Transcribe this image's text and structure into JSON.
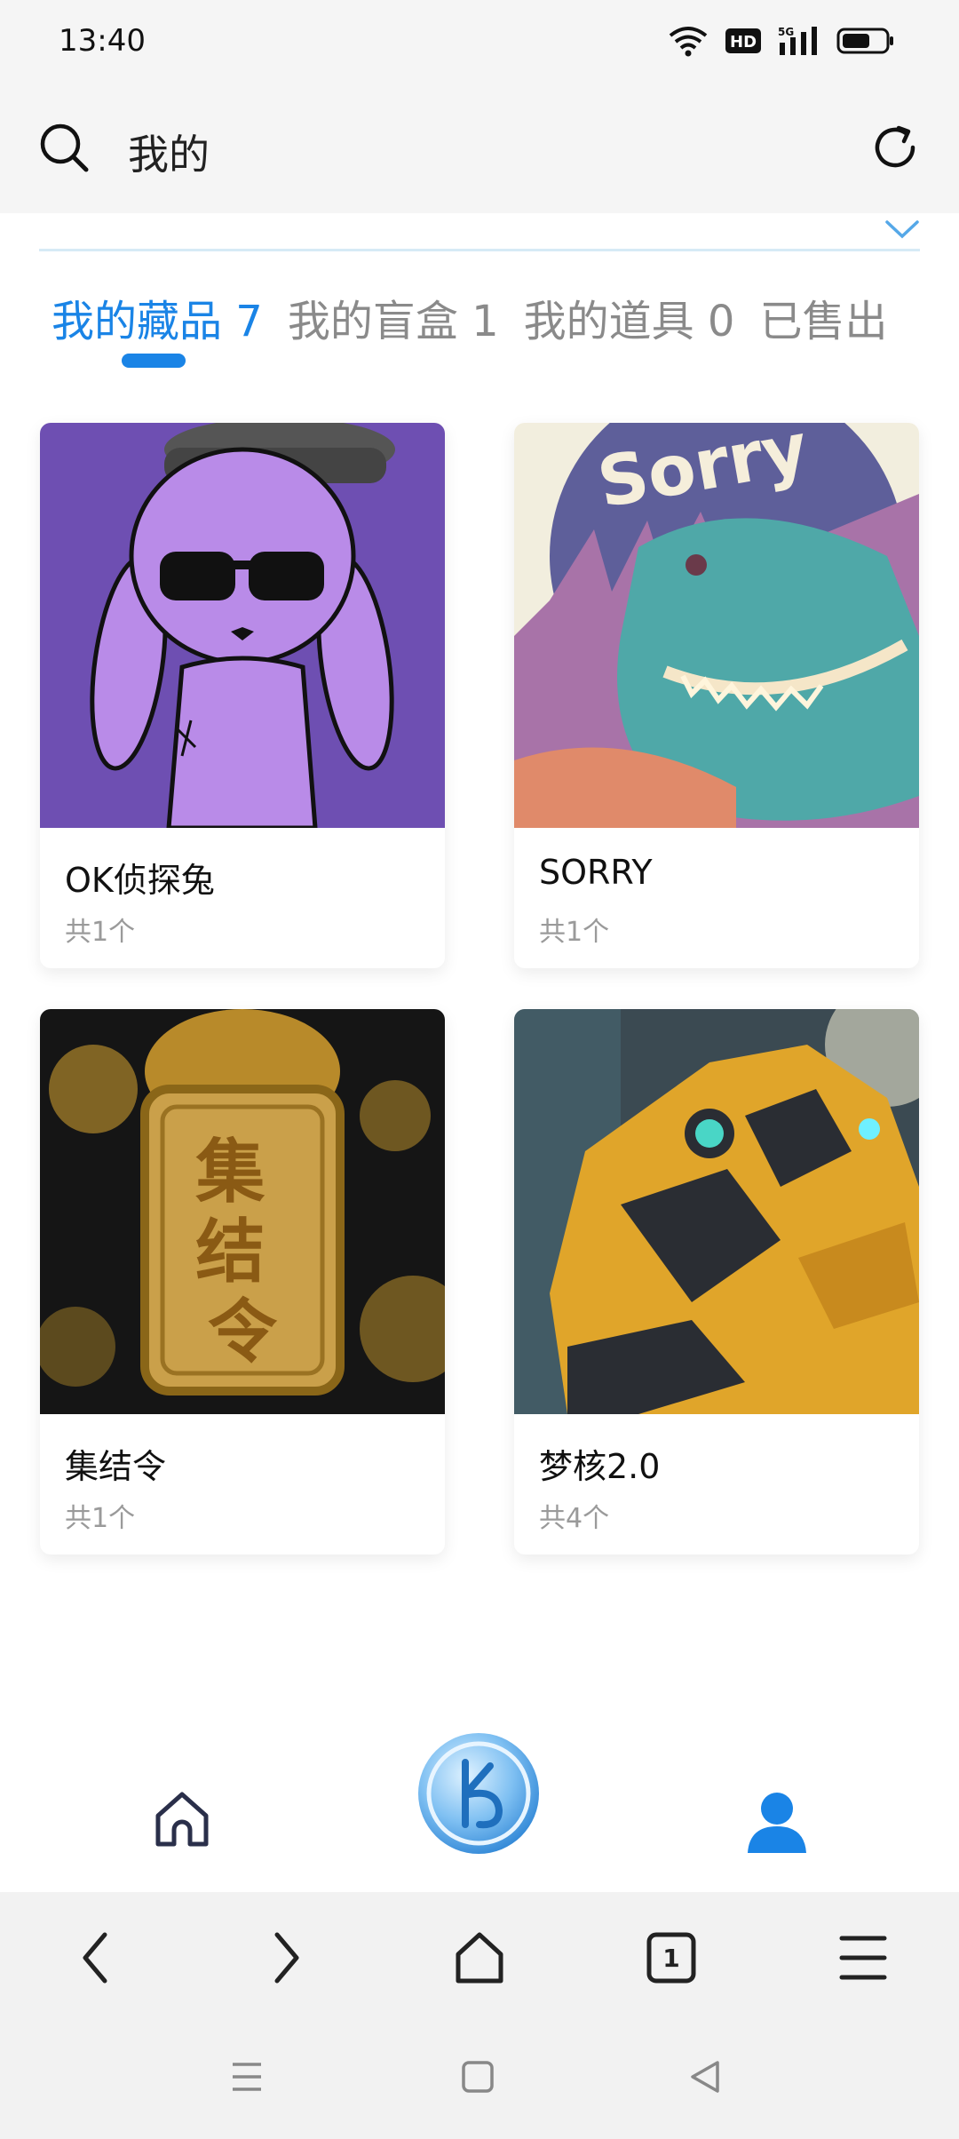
{
  "status_bar": {
    "time": "13:40",
    "hd_label": "HD",
    "network_label": "5G"
  },
  "header": {
    "title": "我的"
  },
  "tabs": [
    {
      "label": "我的藏品 7",
      "active": true
    },
    {
      "label": "我的盲盒 1",
      "active": false
    },
    {
      "label": "我的道具 0",
      "active": false
    },
    {
      "label": "已售出",
      "active": false
    }
  ],
  "items": [
    {
      "title": "OK侦探兔",
      "count": "共1个"
    },
    {
      "title": "SORRY",
      "count": "共1个"
    },
    {
      "title": "集结令",
      "count": "共1个"
    },
    {
      "title": "梦核2.0",
      "count": "共4个"
    }
  ],
  "art_text": {
    "sorry": "Sorry",
    "token": "集结令"
  },
  "browser": {
    "tab_count": "1"
  },
  "colors": {
    "accent": "#1a84e6",
    "inactive_tab": "#8a8a8a"
  },
  "icons": [
    "search-icon",
    "refresh-icon",
    "chevron-down-icon",
    "home-icon",
    "logo-icon",
    "profile-icon",
    "back-icon",
    "forward-icon",
    "tabs-icon",
    "menu-icon"
  ]
}
